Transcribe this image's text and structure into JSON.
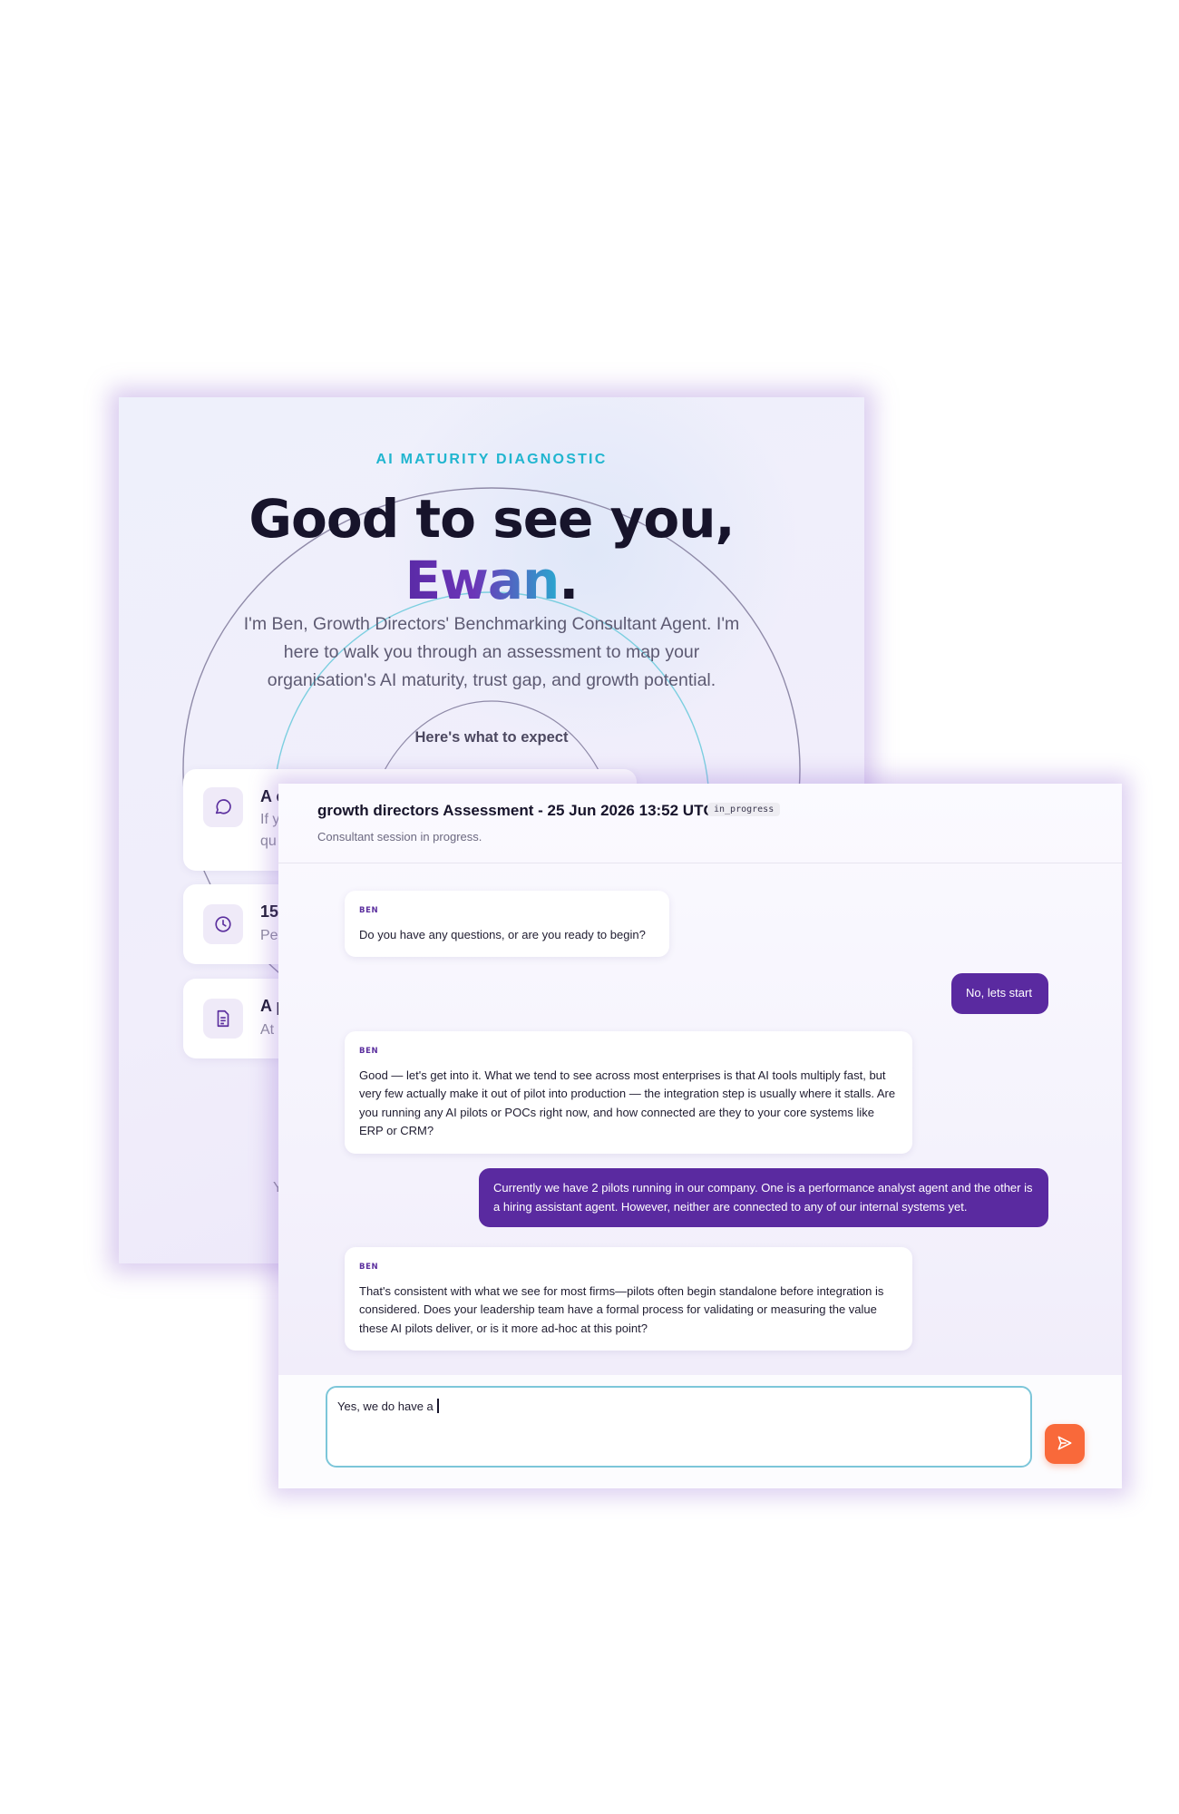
{
  "welcome": {
    "eyebrow": "AI MATURITY DIAGNOSTIC",
    "headline": "Good to see you,",
    "name": "Ewan",
    "name_suffix": ".",
    "intro": "I'm Ben, Growth Directors' Benchmarking Consultant Agent. I'm here to walk you through an assessment to map your organisation's AI maturity, trust gap, and growth potential.",
    "expect_heading": "Here's what to expect",
    "features": [
      {
        "icon": "chat-bubble-icon",
        "title_visible": "A c",
        "sub_visible": "If y\nqu"
      },
      {
        "icon": "clock-icon",
        "title_visible": "15-",
        "sub_visible": "Per"
      },
      {
        "icon": "document-icon",
        "title_visible": "A p",
        "sub_visible": "At"
      }
    ],
    "trailing_text": "Y",
    "colors": {
      "accent_cyan": "#20b5cf",
      "accent_purple": "#5a2aa6"
    }
  },
  "chat": {
    "title": "growth directors Assessment - 25 Jun 2026 13:52 UTC",
    "status": "in_progress",
    "subtitle": "Consultant session in progress.",
    "messages": [
      {
        "role": "agent",
        "sender": "BEN",
        "text": "Do you have any questions, or are you ready to begin?"
      },
      {
        "role": "user",
        "text": "No, lets start"
      },
      {
        "role": "agent",
        "sender": "BEN",
        "text": "Good — let's get into it. What we tend to see across most enterprises is that AI tools multiply fast, but very few actually make it out of pilot into production — the integration step is usually where it stalls. Are you running any AI pilots or POCs right now, and how connected are they to your core systems like ERP or CRM?"
      },
      {
        "role": "user",
        "text": "Currently we have 2 pilots running in our company. One is a performance analyst agent and the other is a hiring assistant agent. However, neither are connected to any of our internal systems yet."
      },
      {
        "role": "agent",
        "sender": "BEN",
        "text": "That's consistent with what we see for most firms—pilots often begin standalone before integration is considered. Does your leadership team have a formal process for validating or measuring the value these AI pilots deliver, or is it more ad-hoc at this point?"
      }
    ],
    "composer": {
      "value": "Yes, we do have a "
    },
    "send_icon": "send-icon",
    "colors": {
      "user_bubble": "#5a2aa0",
      "send_button": "#f9693a",
      "composer_border": "#7cc6d9"
    }
  }
}
